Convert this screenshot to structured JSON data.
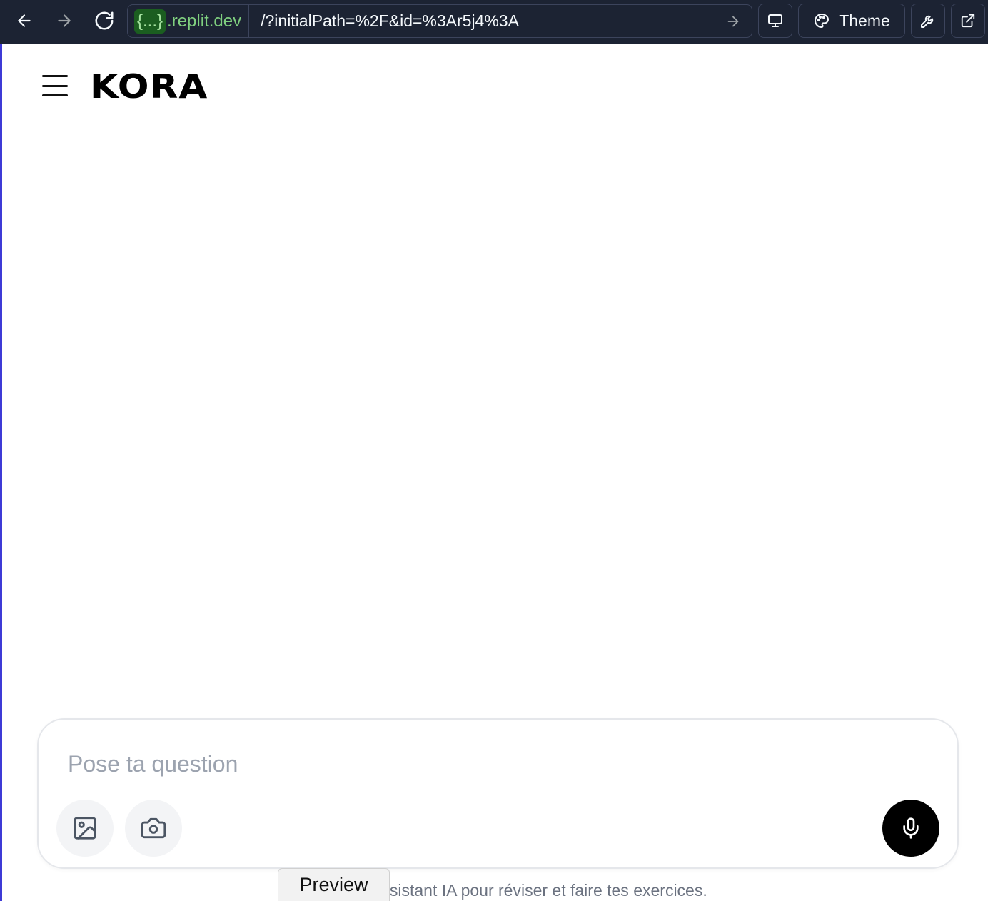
{
  "browser": {
    "domain_braces": "{...}",
    "domain": ".replit.dev",
    "path": "/?initialPath=%2F&id=%3Ar5j4%3A",
    "theme_label": "Theme",
    "icons": [
      "back-arrow-icon",
      "forward-arrow-icon",
      "reload-icon",
      "go-arrow-icon",
      "monitor-icon",
      "palette-icon",
      "wrench-icon",
      "external-link-icon"
    ]
  },
  "app": {
    "logo": "KORA",
    "composer": {
      "placeholder": "Pose ta question"
    },
    "footer": "KORA, ton assistant IA pour réviser et faire tes exercices.",
    "accent_color": "#000000"
  },
  "overlay": {
    "preview_label": "Preview"
  },
  "colors": {
    "chrome_bg": "#1c2333",
    "domain_green": "#7fcf7f",
    "left_border": "#3e3ad6"
  }
}
